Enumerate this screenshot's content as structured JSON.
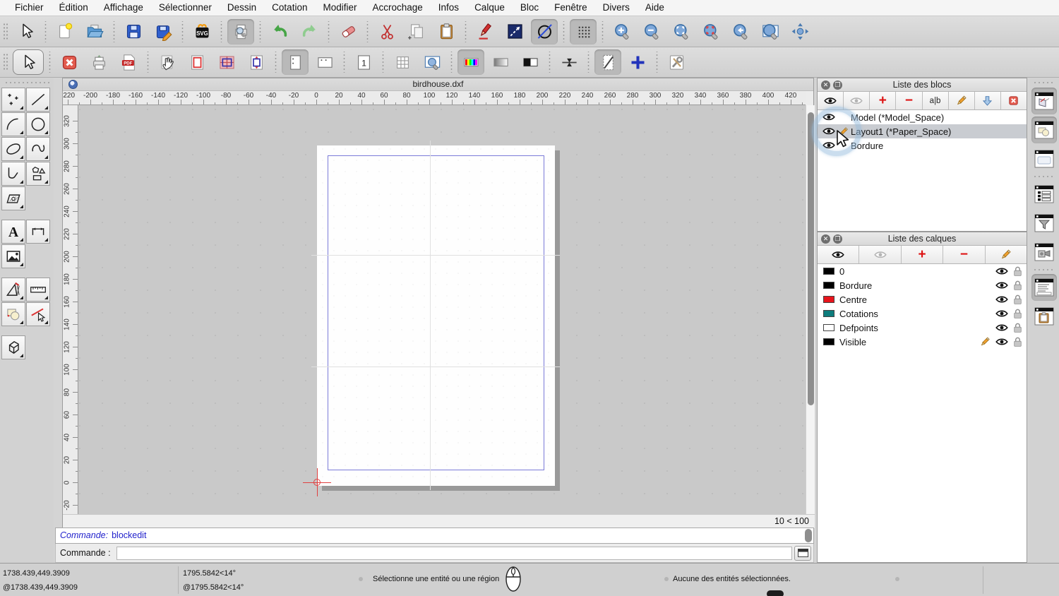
{
  "menubar": {
    "items": [
      "Fichier",
      "Édition",
      "Affichage",
      "Sélectionner",
      "Dessin",
      "Cotation",
      "Modifier",
      "Accrochage",
      "Infos",
      "Calque",
      "Bloc",
      "Fenêtre",
      "Divers",
      "Aide"
    ]
  },
  "icons": {
    "svg_logo": "SVG",
    "pdf_logo": "PDF",
    "page_one_glyph": "1",
    "text_tool_glyph": "A",
    "add_glyph": "+",
    "remove_glyph": "−",
    "rename_glyph": "a|b"
  },
  "toolbar_top": {
    "buttons": [
      {
        "name": "select-cursor",
        "icon": "cursor"
      },
      {
        "name": "new-file",
        "icon": "newfile",
        "sep_before": true
      },
      {
        "name": "open-file",
        "icon": "open"
      },
      {
        "name": "save",
        "icon": "save",
        "sep_before": true
      },
      {
        "name": "save-as",
        "icon": "saveas"
      },
      {
        "name": "svg-export",
        "icon": "svg",
        "sep_before": true
      },
      {
        "name": "print-preview",
        "icon": "printpreview",
        "pressed": true,
        "sep_before": true
      },
      {
        "name": "undo",
        "icon": "undo",
        "sep_before": true
      },
      {
        "name": "redo",
        "icon": "redo"
      },
      {
        "name": "delete-entities",
        "icon": "eraser",
        "sep_before": true
      },
      {
        "name": "cut",
        "icon": "cut",
        "sep_before": true
      },
      {
        "name": "copy",
        "icon": "copy"
      },
      {
        "name": "paste",
        "icon": "paste"
      },
      {
        "name": "pen-edit",
        "icon": "pen",
        "sep_before": true
      },
      {
        "name": "line-attributes",
        "icon": "lineattr"
      },
      {
        "name": "entity-display",
        "icon": "circleslash",
        "pressed": true
      },
      {
        "name": "grid-toggle",
        "icon": "griddots",
        "pressed": true,
        "sep_before": true
      },
      {
        "name": "zoom-in",
        "icon": "zoomin",
        "sep_before": true
      },
      {
        "name": "zoom-out",
        "icon": "zoomout"
      },
      {
        "name": "zoom-auto",
        "icon": "zoomauto"
      },
      {
        "name": "zoom-selection",
        "icon": "zoomsel"
      },
      {
        "name": "zoom-previous",
        "icon": "zoomprev"
      },
      {
        "name": "zoom-window",
        "icon": "zoomwin"
      },
      {
        "name": "zoom-pan",
        "icon": "zoompan"
      }
    ]
  },
  "toolbar_second": {
    "buttons": [
      {
        "name": "select-tool",
        "icon": "cursor",
        "framed": true
      },
      {
        "name": "close-drawing",
        "icon": "closered",
        "sep_before": true
      },
      {
        "name": "print",
        "icon": "print"
      },
      {
        "name": "pdf-export",
        "icon": "pdf"
      },
      {
        "name": "pan-hand",
        "icon": "hand",
        "sep_before": true
      },
      {
        "name": "page-border",
        "icon": "pageborder"
      },
      {
        "name": "page-tiles",
        "icon": "pagetiles"
      },
      {
        "name": "fit-to-page",
        "icon": "pagefit"
      },
      {
        "name": "portrait-orientation",
        "icon": "portrait",
        "pressed": true,
        "sep_before": true
      },
      {
        "name": "landscape-orientation",
        "icon": "landscape"
      },
      {
        "name": "page-count",
        "icon": "pageone",
        "sep_before": true
      },
      {
        "name": "grid-setup",
        "icon": "gridicon",
        "sep_before": true
      },
      {
        "name": "zoom-page",
        "icon": "zoompage"
      },
      {
        "name": "full-color-mode",
        "icon": "colorbar",
        "pressed": true,
        "sep_before": true
      },
      {
        "name": "grayscale-mode",
        "icon": "graybar"
      },
      {
        "name": "black-white-mode",
        "icon": "bwbar"
      },
      {
        "name": "center-spacing",
        "icon": "spacing",
        "sep_before": true
      },
      {
        "name": "draft-mode",
        "icon": "draft",
        "pressed": true,
        "sep_before": true
      },
      {
        "name": "crosshair-toggle",
        "icon": "crossblue"
      },
      {
        "name": "preferences",
        "icon": "wrench",
        "sep_before": true
      }
    ]
  },
  "left_palette": {
    "groups": [
      {
        "rows": [
          [
            "points",
            "line"
          ],
          [
            "arc",
            "circle"
          ],
          [
            "ellipse",
            "spline"
          ],
          [
            "polyline",
            "polygon"
          ],
          [
            "hatch"
          ]
        ]
      },
      {
        "rows": [
          [
            "text",
            "dimension"
          ],
          [
            "image"
          ]
        ]
      },
      {
        "rows": [
          [
            "modify",
            "measure"
          ],
          [
            "blocks",
            "deselect"
          ]
        ]
      },
      {
        "rows": [
          [
            "solid3d"
          ]
        ]
      }
    ]
  },
  "drawing": {
    "title": "birdhouse.dxf",
    "grid_status": "10 < 100",
    "rulers": {
      "h_min": -220,
      "h_max": 420,
      "v_min": -20,
      "v_max": 320,
      "step": 20
    }
  },
  "command": {
    "history_label": "Commande:",
    "history_value": "blockedit",
    "prompt_label": "Commande :",
    "input_value": "",
    "input_placeholder": ""
  },
  "statusbar": {
    "abs_coord": "1738.439,449.3909",
    "rel_coord": "@1738.439,449.3909",
    "abs_polar": "1795.5842<14°",
    "rel_polar": "@1795.5842<14°",
    "hint": "Sélectionne une entité ou une région",
    "selection_info": "Aucune des entités sélectionnées."
  },
  "blocks_panel": {
    "title": "Liste des blocs",
    "toolbar": [
      {
        "name": "show-all-blocks",
        "icon": "eye"
      },
      {
        "name": "hide-all-blocks",
        "icon": "eyegray"
      },
      {
        "name": "add-block",
        "icon": "plus"
      },
      {
        "name": "remove-block",
        "icon": "minus"
      },
      {
        "name": "rename-block",
        "icon": "rename"
      },
      {
        "name": "edit-block",
        "icon": "pencil"
      },
      {
        "name": "insert-block",
        "icon": "insertarrow"
      },
      {
        "name": "toggle-block-visibility",
        "icon": "redxsmall"
      }
    ],
    "items": [
      {
        "label": "Model (*Model_Space)",
        "selected": false,
        "editing": false
      },
      {
        "label": "Layout1 (*Paper_Space)",
        "selected": true,
        "editing": true
      },
      {
        "label": "Bordure",
        "selected": false,
        "editing": false
      }
    ]
  },
  "layers_panel": {
    "title": "Liste des calques",
    "toolbar": [
      {
        "name": "show-all-layers",
        "icon": "eye"
      },
      {
        "name": "hide-all-layers",
        "icon": "eyegray"
      },
      {
        "name": "add-layer",
        "icon": "plus"
      },
      {
        "name": "remove-layer",
        "icon": "minus"
      },
      {
        "name": "edit-layer",
        "icon": "pencil"
      }
    ],
    "items": [
      {
        "label": "0",
        "color": "#000000",
        "current": false
      },
      {
        "label": "Bordure",
        "color": "#000000",
        "current": false
      },
      {
        "label": "Centre",
        "color": "#e8141c",
        "current": false
      },
      {
        "label": "Cotations",
        "color": "#0d7c7c",
        "current": false
      },
      {
        "label": "Defpoints",
        "color": "#ffffff",
        "current": false
      },
      {
        "label": "Visible",
        "color": "#000000",
        "current": true
      }
    ]
  },
  "dock": {
    "buttons": [
      {
        "name": "library-browser-widget",
        "icon": "dlib",
        "pressed": true
      },
      {
        "name": "block-widget",
        "icon": "dblock",
        "pressed": true
      },
      {
        "name": "property-widget",
        "icon": "dblank",
        "pressed": false
      },
      {
        "name": "sep"
      },
      {
        "name": "layer-widget",
        "icon": "dlist",
        "pressed": false
      },
      {
        "name": "filter-widget",
        "icon": "dfilter",
        "pressed": false
      },
      {
        "name": "view-widget",
        "icon": "dcam",
        "pressed": false
      },
      {
        "name": "sep"
      },
      {
        "name": "command-widget",
        "icon": "dcmd",
        "pressed": true
      },
      {
        "name": "clipboard-widget",
        "icon": "dclip",
        "pressed": false
      }
    ]
  }
}
